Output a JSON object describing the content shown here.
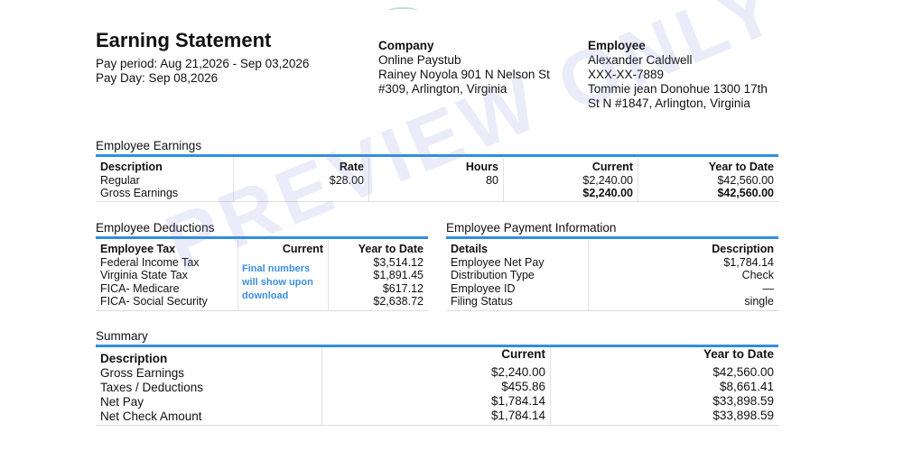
{
  "header": {
    "title": "Earning Statement",
    "pay_period": "Pay period: Aug 21,2026 - Sep 03,2026",
    "pay_day": "Pay Day: Sep 08,2026"
  },
  "company": {
    "heading": "Company",
    "name": "Online Paystub",
    "address_1": "Rainey Noyola 901 N Nelson St",
    "address_2": "#309, Arlington, Virginia"
  },
  "employee": {
    "heading": "Employee",
    "name": "Alexander Caldwell",
    "ssn": "XXX-XX-7889",
    "address_1": "Tommie jean Donohue 1300 17th",
    "address_2": "St N #1847, Arlington, Virginia"
  },
  "earnings": {
    "title": "Employee Earnings",
    "headers": [
      "Description",
      "Rate",
      "Hours",
      "Current",
      "Year to Date"
    ],
    "rows": [
      [
        "Regular",
        "$28.00",
        "80",
        "$2,240.00",
        "$42,560.00"
      ],
      [
        "Gross Earnings",
        "",
        "",
        "$2,240.00",
        "$42,560.00"
      ]
    ]
  },
  "deductions": {
    "title": "Employee Deductions",
    "headers": [
      "Employee Tax",
      "Current",
      "Year to Date"
    ],
    "rows": [
      [
        "Federal Income Tax",
        "$3,514.12"
      ],
      [
        "Virginia State Tax",
        "$1,891.45"
      ],
      [
        "FICA- Medicare",
        "$617.12"
      ],
      [
        "FICA- Social Security",
        "$2,638.72"
      ]
    ],
    "note": "Final numbers will show upon download"
  },
  "payment_info": {
    "title": "Employee Payment Information",
    "headers": [
      "Details",
      "Description"
    ],
    "rows": [
      [
        "Employee Net Pay",
        "$1,784.14"
      ],
      [
        "Distribution Type",
        "Check"
      ],
      [
        "Employee ID",
        "—"
      ],
      [
        "Filing Status",
        "single"
      ]
    ]
  },
  "summary": {
    "title": "Summary",
    "headers": [
      "Description",
      "Current",
      "Year to Date"
    ],
    "rows": [
      [
        "Gross Earnings",
        "$2,240.00",
        "$42,560.00"
      ],
      [
        "Taxes / Deductions",
        "$455.86",
        "$8,661.41"
      ],
      [
        "Net Pay",
        "$1,784.14",
        "$33,898.59"
      ],
      [
        "Net Check Amount",
        "$1,784.14",
        "$33,898.59"
      ]
    ]
  },
  "watermark": "PREVIEW ONLY",
  "colors": {
    "accent_bar": "#2f8fe0",
    "note_text": "#3c8fe0"
  }
}
